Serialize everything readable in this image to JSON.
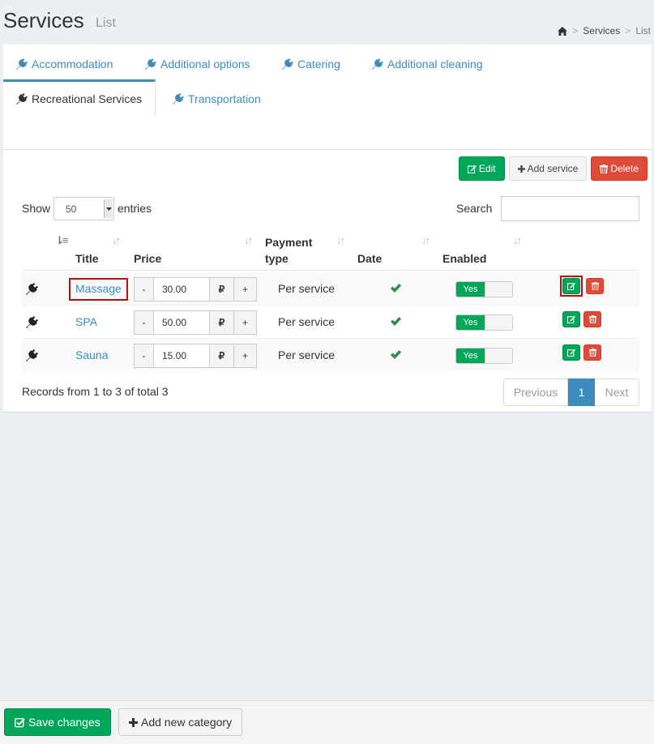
{
  "header": {
    "title": "Services",
    "subtitle": "List"
  },
  "breadcrumb": {
    "items": [
      "Services",
      "List"
    ]
  },
  "tabs": [
    {
      "label": "Accommodation",
      "active": false
    },
    {
      "label": "Additional options",
      "active": false
    },
    {
      "label": "Catering",
      "active": false
    },
    {
      "label": "Additional cleaning",
      "active": false
    },
    {
      "label": "Recreational Services",
      "active": true
    },
    {
      "label": "Transportation",
      "active": false
    }
  ],
  "toolbar": {
    "edit_label": "Edit",
    "add_label": "Add service",
    "delete_label": "Delete"
  },
  "table_controls": {
    "show_label": "Show",
    "page_size": "50",
    "entries_label": "entries",
    "search_label": "Search",
    "search_value": ""
  },
  "table": {
    "columns": {
      "title": "Title",
      "price": "Price",
      "payment_line1": "Payment",
      "payment_line2": "type",
      "date": "Date",
      "enabled": "Enabled"
    },
    "rows": [
      {
        "title": "Massage",
        "price": "30.00",
        "currency": "₽",
        "payment": "Per service",
        "enabled": "Yes"
      },
      {
        "title": "SPA",
        "price": "50.00",
        "currency": "₽",
        "payment": "Per service",
        "enabled": "Yes"
      },
      {
        "title": "Sauna",
        "price": "15.00",
        "currency": "₽",
        "payment": "Per service",
        "enabled": "Yes"
      }
    ],
    "minus": "-",
    "plus": "+"
  },
  "footer_info": {
    "records_text": "Records from 1 to 3 of total 3"
  },
  "pagination": {
    "previous": "Previous",
    "current": "1",
    "next": "Next"
  },
  "footer": {
    "save_label": "Save changes",
    "add_category_label": "Add new category"
  },
  "colors": {
    "primary": "#3c8dbc",
    "success": "#00a65a",
    "danger": "#dd4b39",
    "background": "#ecf0f5"
  }
}
